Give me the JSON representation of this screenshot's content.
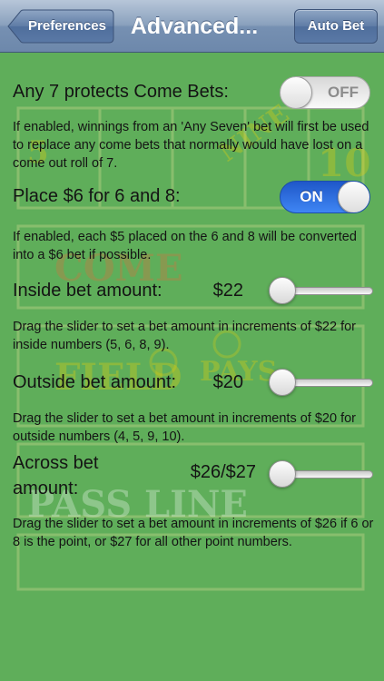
{
  "nav": {
    "back_label": "Preferences",
    "title": "Advanced...",
    "right_label": "Auto Bet"
  },
  "settings": {
    "any7": {
      "label": "Any 7 protects Come Bets:",
      "state": "OFF",
      "description": "If enabled, winnings from an 'Any Seven' bet will first be used to replace any come bets that normally would have lost on a come out roll of 7."
    },
    "place6": {
      "label": "Place $6 for 6 and 8:",
      "state": "ON",
      "description": "If enabled, each $5 placed on the 6 and 8 will be converted into a $6 bet if possible."
    },
    "inside": {
      "label": "Inside bet amount:",
      "amount": "$22",
      "slider_value": 0,
      "description": "Drag the slider to set a bet amount in increments of $22 for inside numbers (5, 6, 8, 9)."
    },
    "outside": {
      "label": "Outside bet amount:",
      "amount": "$20",
      "slider_value": 0,
      "description": "Drag the slider to set a bet amount in increments of $20 for outside numbers (4, 5, 9, 10)."
    },
    "across": {
      "label_line1": "Across bet",
      "label_line2": "amount:",
      "amount": "$26/$27",
      "slider_value": 0,
      "description": "Drag the slider to set a bet amount in increments of $26 if 6 or 8 is the point, or $27 for all other point numbers."
    }
  },
  "colors": {
    "felt": "#5fae5a",
    "switch_on": "#2f6fe0",
    "nav_bar": "#7690b2"
  }
}
